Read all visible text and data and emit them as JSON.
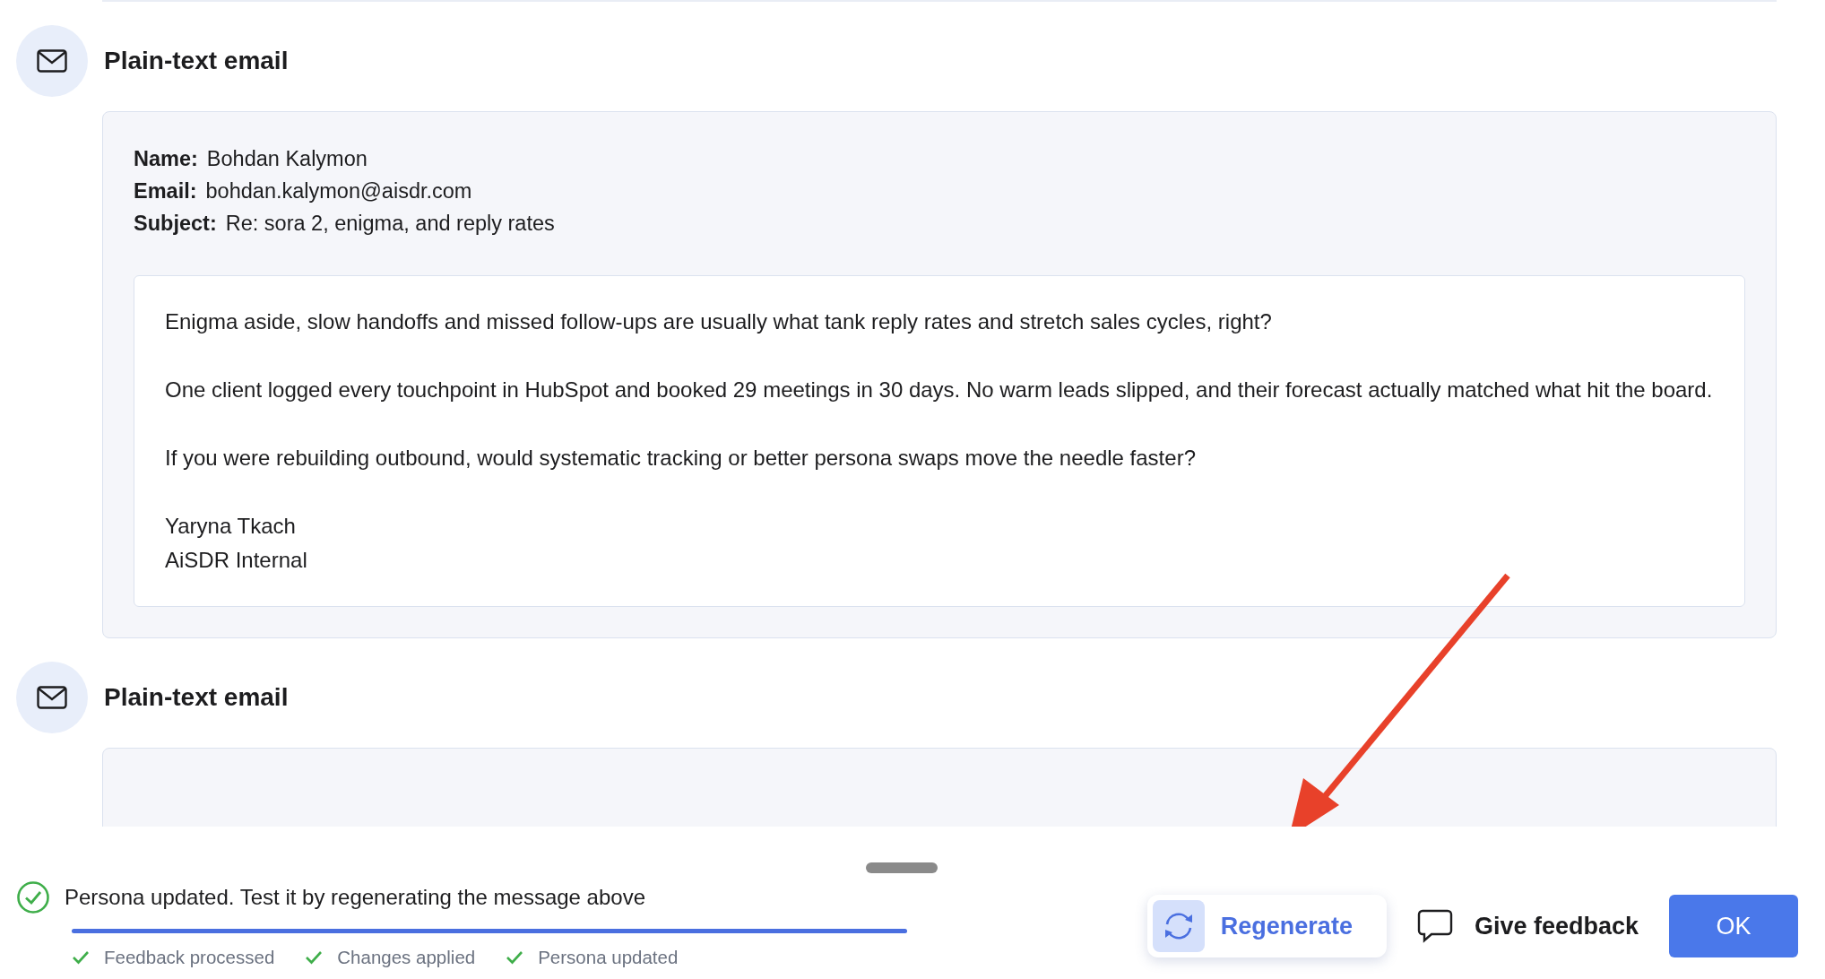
{
  "sections": [
    {
      "title": "Plain-text email",
      "fields": [
        {
          "label": "Name:",
          "value": "Bohdan Kalymon"
        },
        {
          "label": "Email:",
          "value": "bohdan.kalymon@aisdr.com"
        },
        {
          "label": "Subject:",
          "value": "Re: sora 2, enigma, and reply rates"
        }
      ],
      "paragraphs": [
        "Enigma aside, slow handoffs and missed follow-ups are usually what tank reply rates and stretch sales cycles, right?",
        "One client logged every touchpoint in HubSpot and booked 29 meetings in 30 days. No warm leads slipped, and their forecast actually matched what hit the board.",
        "If you were rebuilding outbound, would systematic tracking or better persona swaps move the needle faster?"
      ],
      "signature": [
        "Yaryna Tkach",
        "AiSDR Internal"
      ]
    },
    {
      "title": "Plain-text email"
    }
  ],
  "status": {
    "message": "Persona updated. Test it by regenerating the message above",
    "level": 1,
    "steps": [
      {
        "label": "Feedback processed",
        "done": true
      },
      {
        "label": "Changes applied",
        "done": true
      },
      {
        "label": "Persona updated",
        "done": true
      }
    ]
  },
  "actions": [
    {
      "kind": "regenerate",
      "label": "Regenerate"
    },
    {
      "kind": "feedback",
      "label": "Give feedback"
    },
    {
      "kind": "primary",
      "label": "OK"
    }
  ]
}
